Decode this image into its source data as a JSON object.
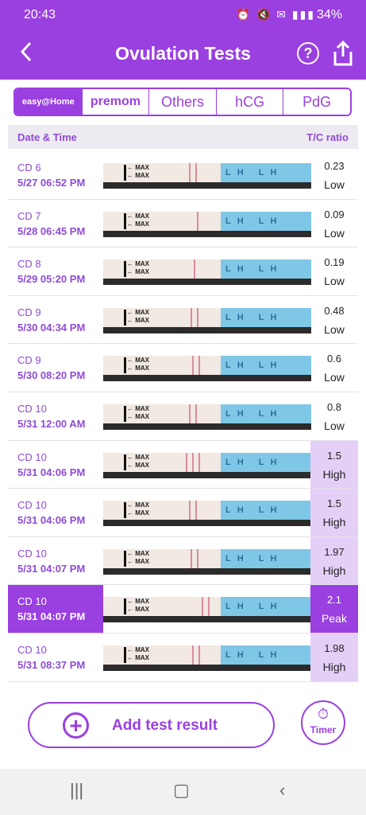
{
  "status": {
    "time": "20:43",
    "icons": "⏰ 🔇 ✉ ▮▮▮",
    "battery": "34%"
  },
  "header": {
    "title": "Ovulation Tests",
    "back_icon": "chevron-left-icon",
    "help_glyph": "?",
    "share_icon": "share-icon"
  },
  "tabs": [
    {
      "label": "easy@Home"
    },
    {
      "label": "premom"
    },
    {
      "label": "Others"
    },
    {
      "label": "hCG"
    },
    {
      "label": "PdG"
    }
  ],
  "table": {
    "col_date": "Date & Time",
    "col_ratio": "T/C ratio"
  },
  "rows": [
    {
      "cd": "CD 6",
      "datetime": "5/27   06:52 PM",
      "ratio": "0.23",
      "level": "Low"
    },
    {
      "cd": "CD 7",
      "datetime": "5/28   06:45 PM",
      "ratio": "0.09",
      "level": "Low"
    },
    {
      "cd": "CD 8",
      "datetime": "5/29   05:20 PM",
      "ratio": "0.19",
      "level": "Low"
    },
    {
      "cd": "CD 9",
      "datetime": "5/30   04:34 PM",
      "ratio": "0.48",
      "level": "Low"
    },
    {
      "cd": "CD 9",
      "datetime": "5/30   08:20 PM",
      "ratio": "0.6",
      "level": "Low"
    },
    {
      "cd": "CD 10",
      "datetime": "5/31   12:00 AM",
      "ratio": "0.8",
      "level": "Low"
    },
    {
      "cd": "CD 10",
      "datetime": "5/31   04:06 PM",
      "ratio": "1.5",
      "level": "High"
    },
    {
      "cd": "CD 10",
      "datetime": "5/31   04:06 PM",
      "ratio": "1.5",
      "level": "High"
    },
    {
      "cd": "CD 10",
      "datetime": "5/31   04:07 PM",
      "ratio": "1.97",
      "level": "High"
    },
    {
      "cd": "CD 10",
      "datetime": "5/31   04:07 PM",
      "ratio": "2.1",
      "level": "Peak"
    },
    {
      "cd": "CD 10",
      "datetime": "5/31   08:37 PM",
      "ratio": "1.98",
      "level": "High"
    }
  ],
  "strip": {
    "max_label": "← MAX",
    "lh_label": "LH LH LH"
  },
  "actions": {
    "add_label": "Add test result",
    "add_glyph": "+",
    "timer_label": "Timer",
    "timer_glyph": "⏱"
  },
  "nav": {
    "recents": "|||",
    "home": "▢",
    "back": "‹"
  },
  "colors": {
    "accent": "#9a3fe0",
    "high": "#e4cff7"
  }
}
